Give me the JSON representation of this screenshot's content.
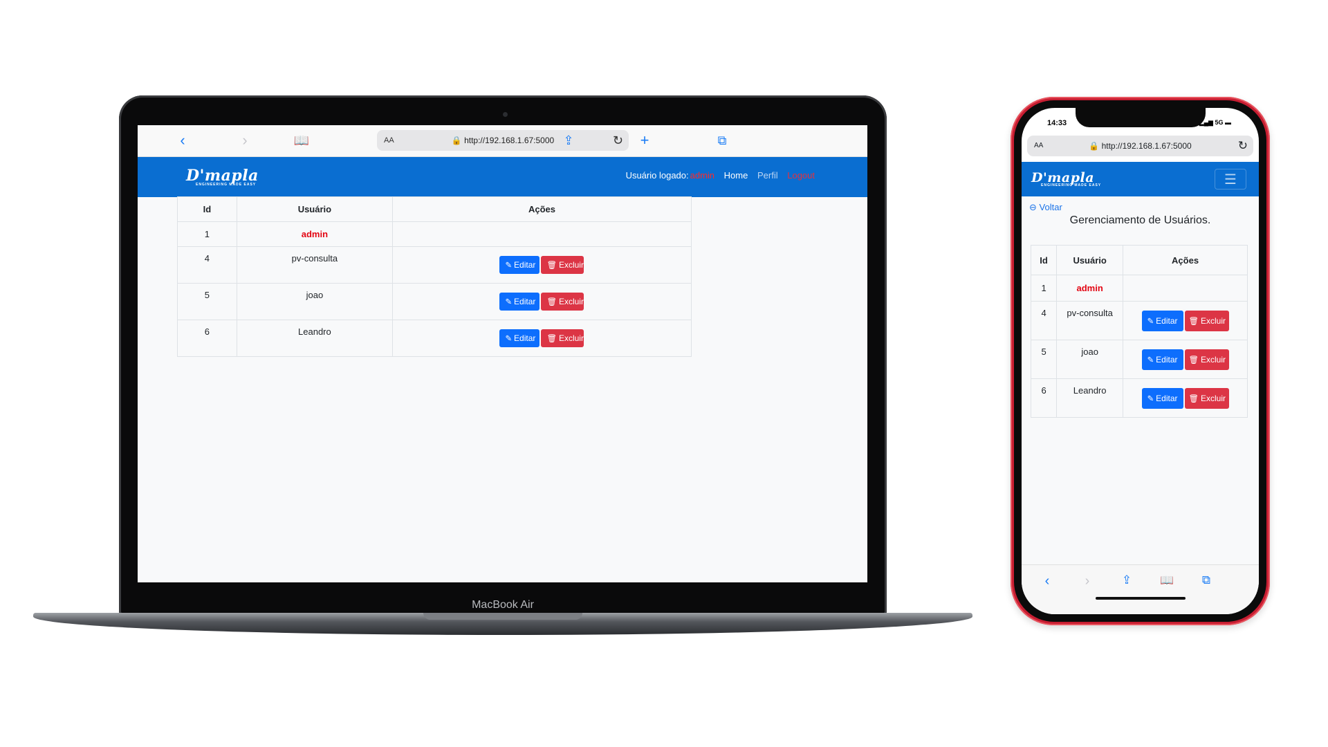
{
  "browser": {
    "url": "http://192.168.1.67:5000",
    "text_size_label": "AA"
  },
  "laptop": {
    "brand": "MacBook Air"
  },
  "phone": {
    "status_time": "14:33",
    "status_network": "5G"
  },
  "app": {
    "logo_text": "D'mapla",
    "logo_subtext": "ENGINEERING MADE EASY",
    "logged_user_label": "Usuário logado:",
    "logged_user": "admin",
    "nav_home": "Home",
    "nav_perfil": "Perfil",
    "nav_logout": "Logout",
    "back_label": "Voltar",
    "page_title": "Gerenciamento de Usuários.",
    "table": {
      "headers": [
        "Id",
        "Usuário",
        "Ações"
      ],
      "rows": [
        {
          "id": "1",
          "user": "admin"
        },
        {
          "id": "4",
          "user": "pv-consulta"
        },
        {
          "id": "5",
          "user": "joao"
        },
        {
          "id": "6",
          "user": "Leandro"
        }
      ]
    },
    "edit_label": "Editar",
    "delete_label": "Excluir"
  },
  "colors": {
    "navbar": "#0a6ed1",
    "edit_button": "#0d6efd",
    "delete_button": "#dc3545",
    "admin_text": "#e30613",
    "phone_frame": "#c81e32"
  },
  "icons": {
    "back": "arrow-left-circle-icon",
    "edit": "pencil-square-icon",
    "delete": "trash-icon"
  }
}
